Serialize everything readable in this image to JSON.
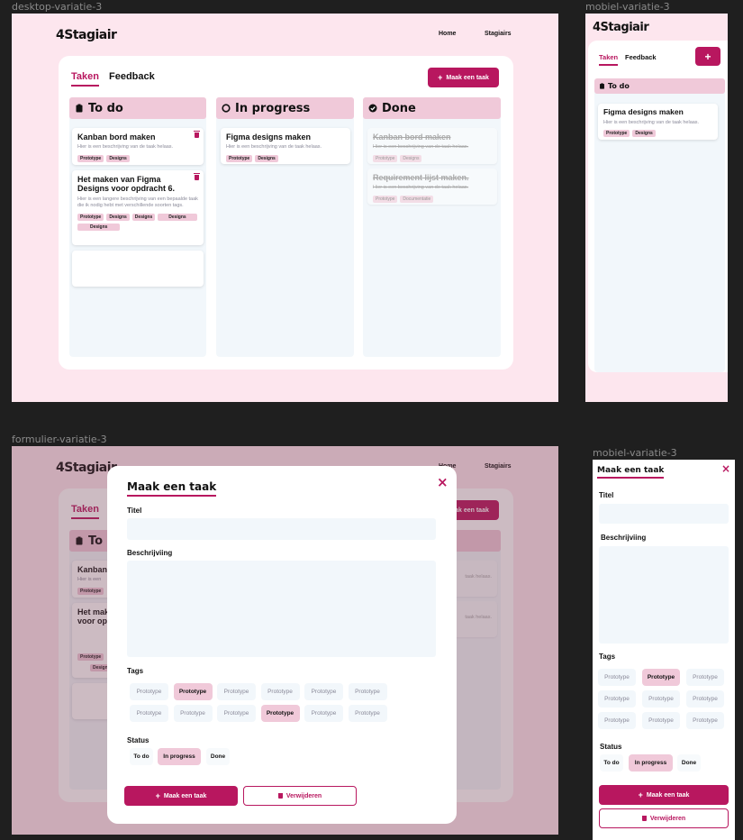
{
  "frames": {
    "desktop": "desktop-variatie-3",
    "mobile_top": "mobiel-variatie-3",
    "form": "formulier-variatie-3",
    "mobile_bottom": "mobiel-variatie-3"
  },
  "brand": {
    "logo": "4Stagiair",
    "accent": "#b8175f",
    "pink_bg": "#fde6ee",
    "tag_bg": "#f0c9d9"
  },
  "nav": {
    "home": "Home",
    "stagiairs": "Stagiairs"
  },
  "tabs": {
    "tasks": "Taken",
    "feedback": "Feedback"
  },
  "actions": {
    "create_task": "Maak een taak",
    "delete": "Verwijderen"
  },
  "columns": {
    "todo": {
      "title": "To do",
      "icon": "clipboard-icon"
    },
    "progress": {
      "title": "In progress",
      "icon": "circle-notch-icon"
    },
    "done": {
      "title": "Done",
      "icon": "check-circle-icon"
    }
  },
  "tasks": {
    "todo1": {
      "title": "Kanban bord maken",
      "desc": "Hier is een beschrijving van de taak helaas.",
      "tags": [
        "Prototype",
        "Designs"
      ]
    },
    "todo2": {
      "title": "Het maken van Figma Designs voor opdracht 6.",
      "desc": "Hier is een langere beschrijving van een bepaalde taak die ik nodig hebt met verschillende soorten tags.",
      "tags": [
        "Prototype",
        "Designs",
        "Designs",
        "Designs",
        "Designs"
      ]
    },
    "progress1": {
      "title": "Figma designs maken",
      "desc": "Hier is een beschrijving van de taak helaas.",
      "tags": [
        "Prototype",
        "Designs"
      ]
    },
    "done1": {
      "title": "Kanban bord maken",
      "desc": "Hier is een beschrijving van de taak helaas.",
      "tags": [
        "Prototype",
        "Designs"
      ]
    },
    "done2": {
      "title": "Requirement lijst maken.",
      "desc": "Hier is een beschrijving van de taak helaas.",
      "tags": [
        "Prototype",
        "Documentatie"
      ]
    }
  },
  "form": {
    "title": "Maak een taak",
    "close": "×",
    "label_title": "Titel",
    "label_desc": "Beschrijviing",
    "label_tags": "Tags",
    "label_status": "Status",
    "tag_options": [
      "Prototype",
      "Prototype",
      "Prototype",
      "Prototype",
      "Prototype",
      "Prototype",
      "Prototype",
      "Prototype",
      "Prototype",
      "Prototype",
      "Prototype",
      "Prototype"
    ],
    "selected_tags": [
      1,
      9
    ],
    "mobile_tag_options": [
      "Prototype",
      "Prototype",
      "Prototype",
      "Prototype",
      "Prototype",
      "Prototype",
      "Prototype",
      "Prototype",
      "Prototype"
    ],
    "mobile_selected_tags": [
      1
    ],
    "status_options": [
      "To do",
      "In progress",
      "Done"
    ],
    "selected_status": "In progress"
  },
  "background_fragments": {
    "todo_partial": "To d",
    "task1_partial": "Kanban",
    "task1_desc_partial": "Hier is een",
    "task2_partial_a": "Het mak",
    "task2_partial_b": "voor opd",
    "done_desc_partial": "taak helaas.",
    "tag_partial": "Prototype",
    "tag_partial2": "Design"
  }
}
